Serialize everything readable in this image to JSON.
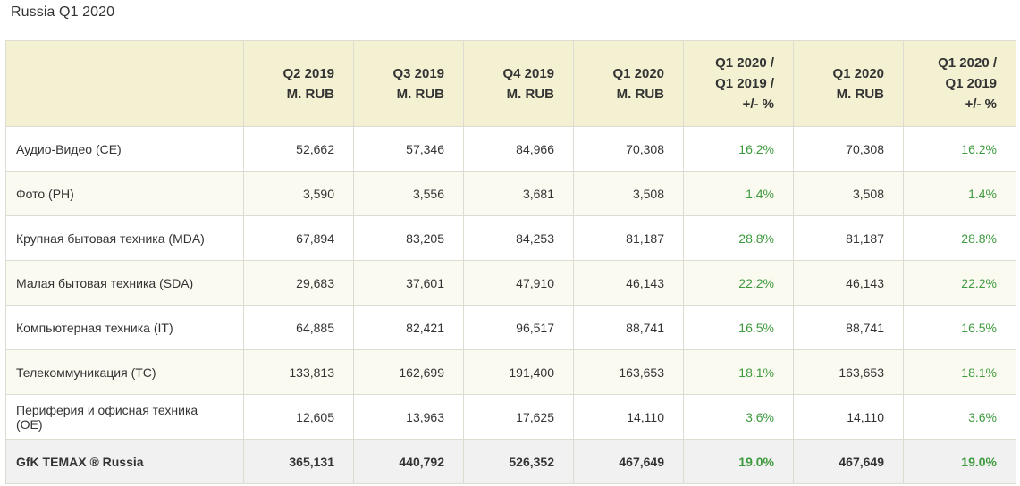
{
  "title": "Russia Q1 2020",
  "headers": [
    [
      "Q2 2019",
      "M. RUB"
    ],
    [
      "Q3 2019",
      "M. RUB"
    ],
    [
      "Q4 2019",
      "M. RUB"
    ],
    [
      "Q1 2020",
      "M. RUB"
    ],
    [
      "Q1 2020 /",
      "Q1 2019 /",
      "+/- %"
    ],
    [
      "Q1 2020",
      "M. RUB"
    ],
    [
      "Q1 2020 /",
      "Q1 2019",
      "+/- %"
    ]
  ],
  "rows": [
    {
      "category": "Аудио-Видео (CE)",
      "values": [
        "52,662",
        "57,346",
        "84,966",
        "70,308",
        "16.2%",
        "70,308",
        "16.2%"
      ]
    },
    {
      "category": "Фото (PH)",
      "values": [
        "3,590",
        "3,556",
        "3,681",
        "3,508",
        "1.4%",
        "3,508",
        "1.4%"
      ]
    },
    {
      "category": "Крупная бытовая техника (MDA)",
      "values": [
        "67,894",
        "83,205",
        "84,253",
        "81,187",
        "28.8%",
        "81,187",
        "28.8%"
      ]
    },
    {
      "category": "Малая бытовая техника (SDA)",
      "values": [
        "29,683",
        "37,601",
        "47,910",
        "46,143",
        "22.2%",
        "46,143",
        "22.2%"
      ]
    },
    {
      "category": "Компьютерная техника (IT)",
      "values": [
        "64,885",
        "82,421",
        "96,517",
        "88,741",
        "16.5%",
        "88,741",
        "16.5%"
      ]
    },
    {
      "category": "Телекоммуникация (TC)",
      "values": [
        "133,813",
        "162,699",
        "191,400",
        "163,653",
        "18.1%",
        "163,653",
        "18.1%"
      ]
    },
    {
      "category": "Периферия и офисная техника (OE)",
      "values": [
        "12,605",
        "13,963",
        "17,625",
        "14,110",
        "3.6%",
        "14,110",
        "3.6%"
      ]
    }
  ],
  "total": {
    "category": "GfK TEMAX ® Russia",
    "values": [
      "365,131",
      "440,792",
      "526,352",
      "467,649",
      "19.0%",
      "467,649",
      "19.0%"
    ]
  },
  "colors": {
    "header_bg": "#f3f1d1",
    "positive": "#3e9a3e",
    "total_bg": "#f1f1f1"
  }
}
